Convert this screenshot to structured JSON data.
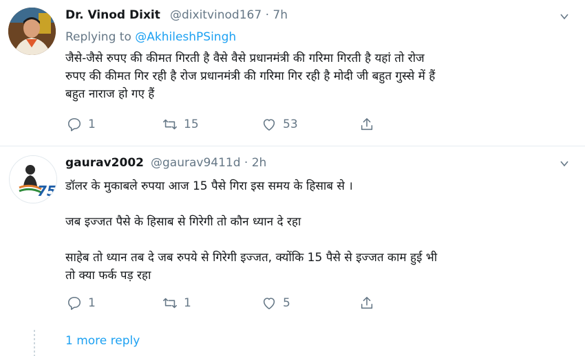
{
  "tweets": [
    {
      "name": "Dr. Vinod Dixit",
      "handle": "@dixitvinod167 · 7h",
      "reply_prefix": "Replying to ",
      "reply_mention": "@AkhileshPSingh",
      "text_lines": [
        "जैसे-जैसे रुपए की कीमत गिरती है वैसे वैसे प्रधानमंत्री की गरिमा गिरती है यहां तो रोज",
        "रुपए की कीमत गिर रही है रोज प्रधानमंत्री की गरिमा गिर रही है मोदी जी बहुत गुस्से में हैं",
        "बहुत नाराज हो गए हैं"
      ],
      "replies": "1",
      "retweets": "15",
      "likes": "53"
    },
    {
      "name": "gaurav2002",
      "handle": "@gaurav9411d · 2h",
      "text_lines": [
        "डॉलर के मुकाबले रुपया आज 15 पैसे गिरा इस समय के हिसाब से ।",
        "जब इज्जत पैसे के हिसाब से गिरेगी तो कौन ध्यान दे रहा",
        "साहेब तो ध्यान तब दे जब रुपये से गिरेगी इज्जत, क्योंकि 15 पैसे से इज्जत काम हुई भी",
        "तो क्या फर्क पड़ रहा"
      ],
      "replies": "1",
      "retweets": "1",
      "likes": "5",
      "avatar_badge": "75"
    }
  ],
  "more_replies": "1 more reply",
  "icons": [
    "reply-icon",
    "retweet-icon",
    "like-icon",
    "share-icon",
    "chevron-down-icon"
  ],
  "colors": {
    "link": "#1da1f2",
    "muted": "#657786",
    "text": "#14171a"
  }
}
